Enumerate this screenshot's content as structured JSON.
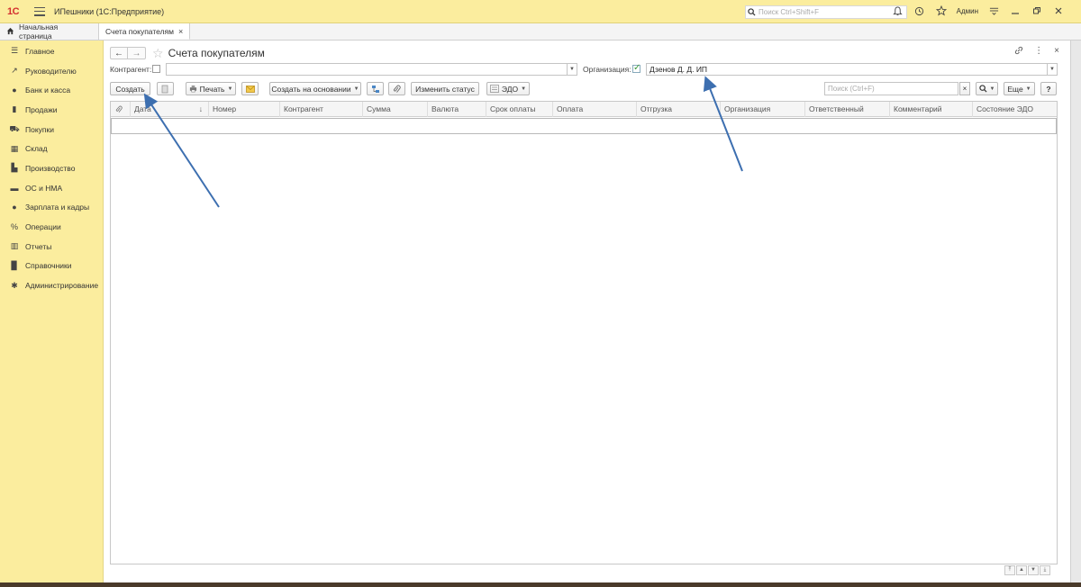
{
  "app": {
    "logo": "1С",
    "title": "ИПешники (1С:Предприятие)",
    "search_placeholder": "Поиск Ctrl+Shift+F",
    "user": "Админ"
  },
  "tabs": {
    "home": "Начальная страница",
    "active": "Счета покупателям"
  },
  "sidebar": {
    "items": [
      {
        "label": "Главное",
        "icon": "menu-icon"
      },
      {
        "label": "Руководителю",
        "icon": "chart-line-icon"
      },
      {
        "label": "Банк и касса",
        "icon": "coin-icon"
      },
      {
        "label": "Продажи",
        "icon": "bag-icon"
      },
      {
        "label": "Покупки",
        "icon": "cart-icon"
      },
      {
        "label": "Склад",
        "icon": "warehouse-icon"
      },
      {
        "label": "Производство",
        "icon": "factory-icon"
      },
      {
        "label": "ОС и НМА",
        "icon": "truck-icon"
      },
      {
        "label": "Зарплата и кадры",
        "icon": "person-icon"
      },
      {
        "label": "Операции",
        "icon": "operations-icon"
      },
      {
        "label": "Отчеты",
        "icon": "bar-chart-icon"
      },
      {
        "label": "Справочники",
        "icon": "book-icon"
      },
      {
        "label": "Администрирование",
        "icon": "gear-icon"
      }
    ]
  },
  "form": {
    "title": "Счета покупателям",
    "filters": {
      "kontragent_label": "Контрагент:",
      "kontragent_value": "",
      "organization_label": "Организация:",
      "organization_value": "Дзенов Д. Д. ИП"
    },
    "toolbar": {
      "create": "Создать",
      "print": "Печать",
      "create_based": "Создать на основании",
      "change_status": "Изменить статус",
      "edo": "ЭДО",
      "search_placeholder": "Поиск (Ctrl+F)",
      "more": "Еще",
      "help": "?"
    },
    "columns": [
      "Дата",
      "Номер",
      "Контрагент",
      "Сумма",
      "Валюта",
      "Срок оплаты",
      "Оплата",
      "Отгрузка",
      "Организация",
      "Ответственный",
      "Комментарий",
      "Состояние ЭДО"
    ]
  },
  "colors": {
    "panel_yellow": "#fbed9e",
    "arrow_blue": "#3d6fb0"
  }
}
